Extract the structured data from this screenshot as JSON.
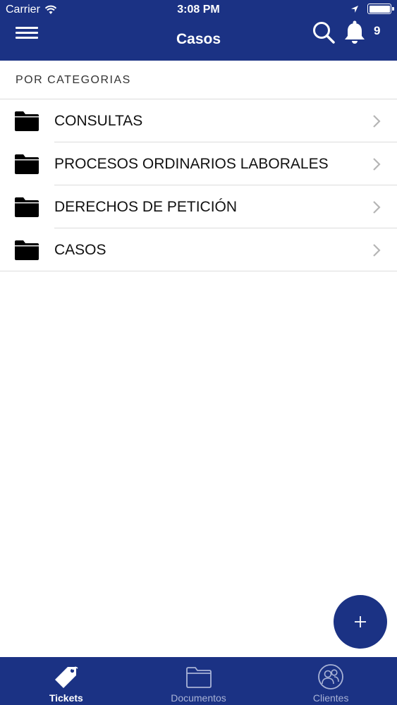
{
  "status_bar": {
    "carrier": "Carrier",
    "time": "3:08 PM"
  },
  "nav": {
    "title": "Casos",
    "notification_count": "9"
  },
  "section": {
    "title": "POR CATEGORIAS"
  },
  "categories": [
    {
      "label": "CONSULTAS"
    },
    {
      "label": "PROCESOS ORDINARIOS LABORALES"
    },
    {
      "label": "DERECHOS DE PETICIÓN"
    },
    {
      "label": "CASOS"
    }
  ],
  "tabs": [
    {
      "label": "Tickets",
      "icon": "tag-icon",
      "active": true
    },
    {
      "label": "Documentos",
      "icon": "folder-icon",
      "active": false
    },
    {
      "label": "Clientes",
      "icon": "users-icon",
      "active": false
    }
  ],
  "colors": {
    "primary": "#1b3284",
    "inactive_tab": "#a9b3d6"
  }
}
